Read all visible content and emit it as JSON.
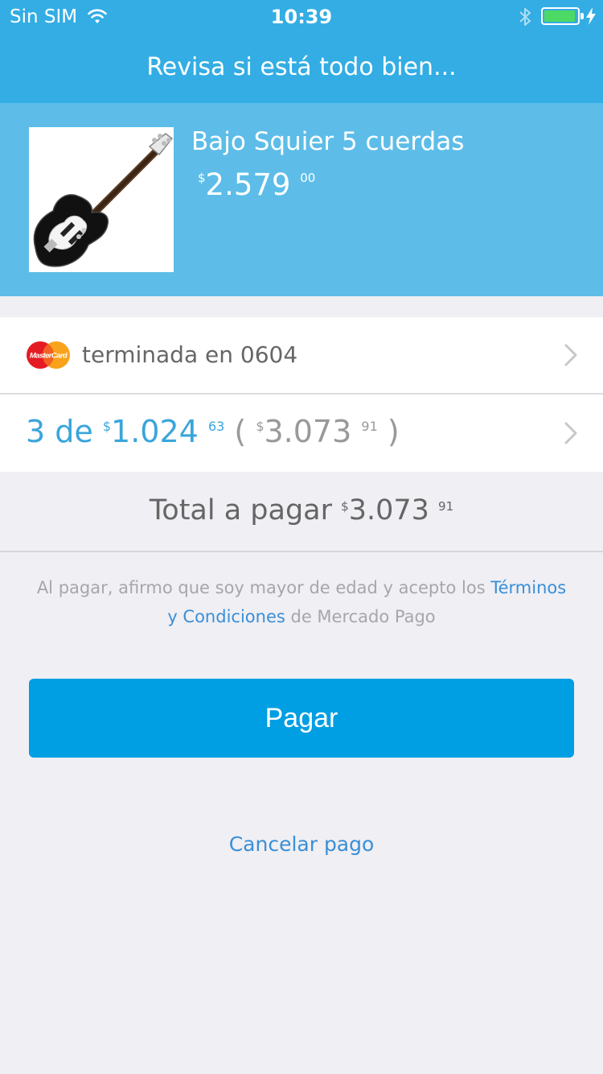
{
  "status_bar": {
    "carrier": "Sin SIM",
    "time": "10:39",
    "battery_level": 0.95,
    "battery_color": "#4cd964"
  },
  "nav": {
    "title": "Revisa si está todo bien..."
  },
  "product": {
    "name": "Bajo Squier 5 cuerdas",
    "currency_symbol": "$",
    "price_integer": "2.579",
    "price_cents": "00",
    "image": "bass-guitar-image"
  },
  "payment": {
    "card_brand": "MasterCard",
    "card_text": "terminada en 0604",
    "installments": {
      "count_text": "3 de",
      "currency_symbol": "$",
      "amount_integer": "1.024",
      "amount_cents": "63",
      "total_open": "(",
      "total_integer": "3.073",
      "total_cents": "91",
      "total_close": ")"
    }
  },
  "total": {
    "label": "Total a pagar",
    "currency_symbol": "$",
    "amount_integer": "3.073",
    "amount_cents": "91"
  },
  "legal": {
    "prefix": "Al pagar, afirmo que soy mayor de edad y acepto los ",
    "link": "Términos y Condiciones",
    "suffix": " de Mercado Pago"
  },
  "actions": {
    "pay_label": "Pagar",
    "cancel_label": "Cancelar pago"
  },
  "colors": {
    "header": "#33ade4",
    "product_band": "#5dbde8",
    "primary_button": "#009ee3",
    "link": "#3a8fd6"
  }
}
